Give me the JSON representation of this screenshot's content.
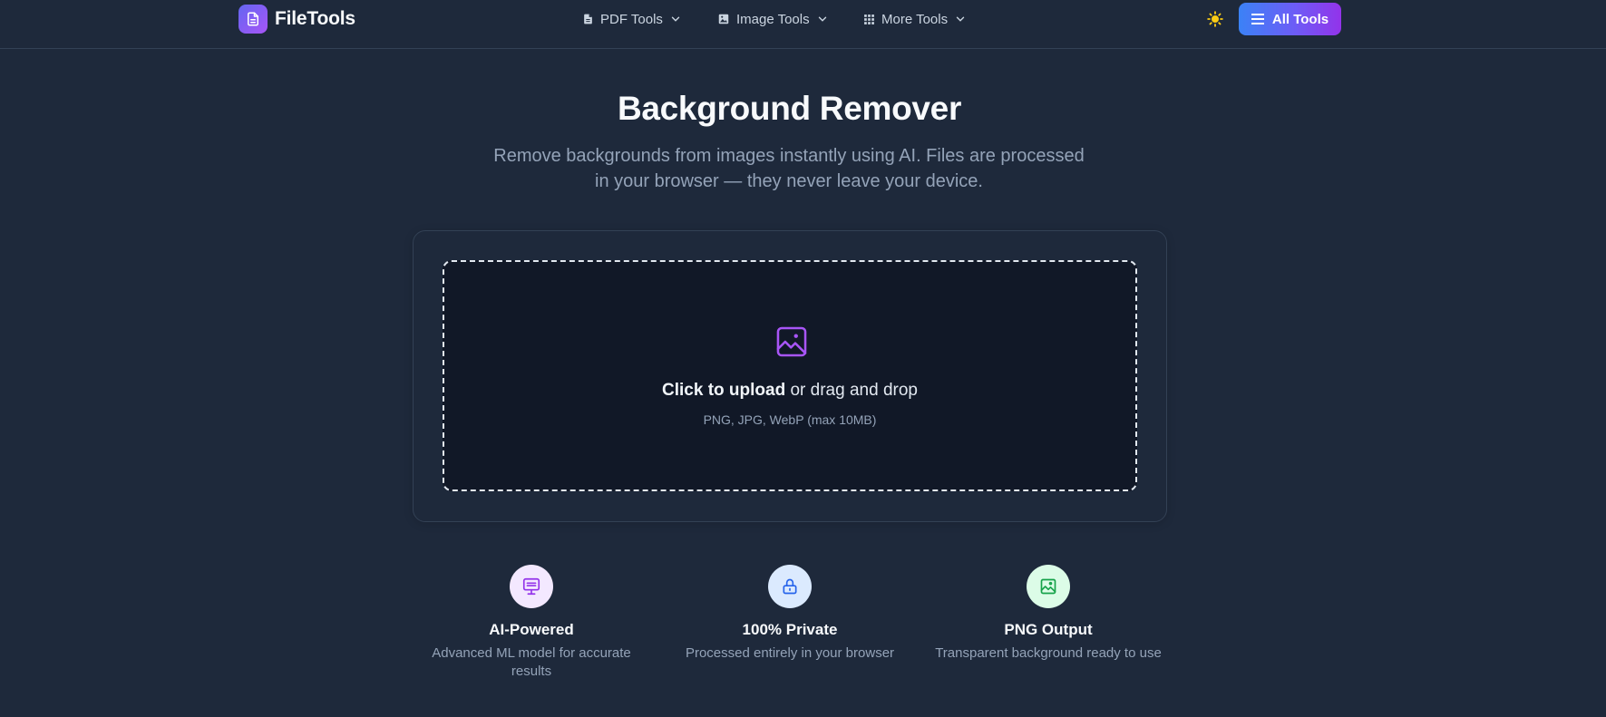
{
  "header": {
    "brand": "FileTools",
    "nav": [
      {
        "label": "PDF Tools",
        "icon": "file-icon"
      },
      {
        "label": "Image Tools",
        "icon": "image-icon"
      },
      {
        "label": "More Tools",
        "icon": "grid-icon"
      }
    ],
    "theme_icon": "sun-icon",
    "all_tools_label": "All Tools"
  },
  "hero": {
    "title": "Background Remover",
    "subtitle": "Remove backgrounds from images instantly using AI. Files are processed in your browser — they never leave your device."
  },
  "upload": {
    "cta_bold": "Click to upload",
    "cta_rest": " or drag and drop",
    "hint": "PNG, JPG, WebP (max 10MB)"
  },
  "features": [
    {
      "title": "AI-Powered",
      "desc": "Advanced ML model for accurate results",
      "icon": "monitor-icon",
      "color": "#9333ea",
      "bg": "#f3e8ff"
    },
    {
      "title": "100% Private",
      "desc": "Processed entirely in your browser",
      "icon": "lock-icon",
      "color": "#2563eb",
      "bg": "#dbeafe"
    },
    {
      "title": "PNG Output",
      "desc": "Transparent background ready to use",
      "icon": "image-icon",
      "color": "#16a34a",
      "bg": "#dcfce7"
    }
  ],
  "colors": {
    "background": "#1e293b",
    "accent_start": "#3b82f6",
    "accent_end": "#9333ea",
    "sun": "#facc15"
  }
}
